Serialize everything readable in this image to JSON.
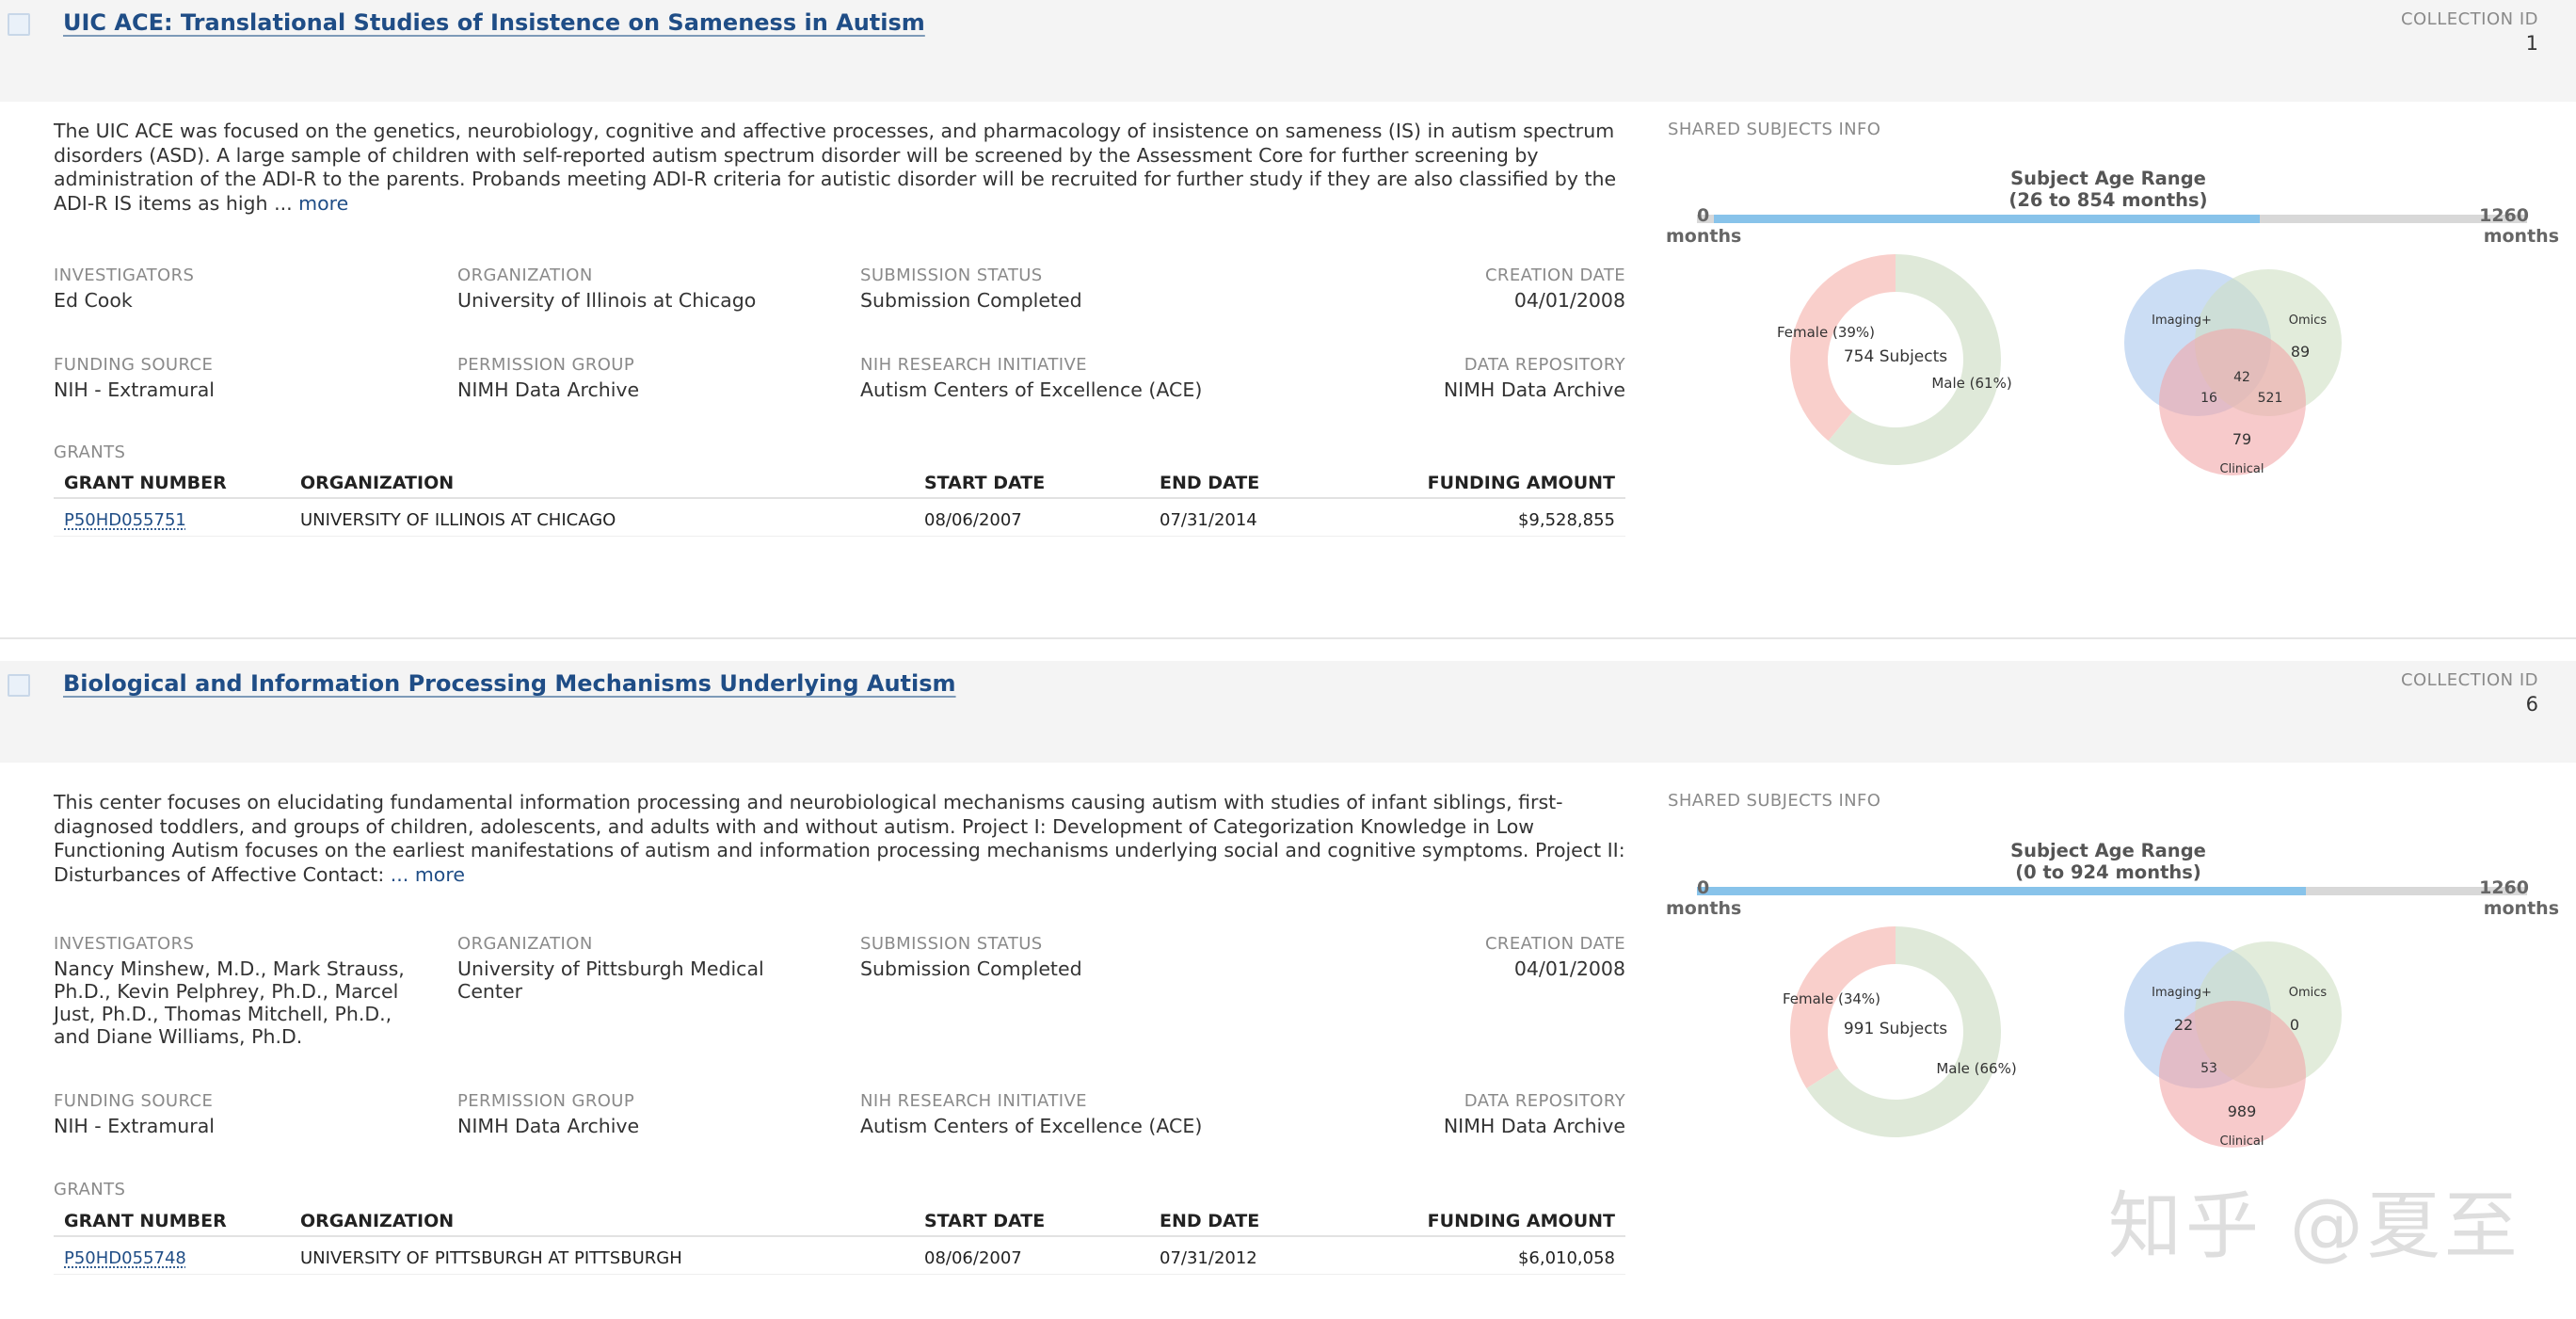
{
  "collections": [
    {
      "title": "UIC ACE: Translational Studies of Insistence on Sameness in Autism",
      "collection_id_label": "COLLECTION ID",
      "collection_id": "1",
      "description": "The UIC ACE was focused on the genetics, neurobiology, cognitive and affective processes, and pharmacology of insistence on sameness (IS) in autism spectrum disorders (ASD). A large sample of children with self-reported autism spectrum disorder will be screened by the Assessment Core for further screening by administration of the ADI-R to the parents. Probands meeting ADI-R criteria for autistic disorder will be recruited for further study if they are also classified by the ADI-R IS items as high ...",
      "more_label": "more",
      "investigators_label": "INVESTIGATORS",
      "investigators": "Ed Cook",
      "organization_label": "ORGANIZATION",
      "organization": "University of Illinois at Chicago",
      "submission_status_label": "SUBMISSION STATUS",
      "submission_status": "Submission Completed",
      "creation_date_label": "CREATION DATE",
      "creation_date": "04/01/2008",
      "funding_source_label": "FUNDING SOURCE",
      "funding_source": "NIH - Extramural",
      "permission_group_label": "PERMISSION GROUP",
      "permission_group": "NIMH Data Archive",
      "research_initiative_label": "NIH RESEARCH INITIATIVE",
      "research_initiative": "Autism Centers of Excellence (ACE)",
      "data_repository_label": "DATA REPOSITORY",
      "data_repository": "NIMH Data Archive",
      "grants_label": "GRANTS",
      "grants_headers": [
        "GRANT NUMBER",
        "ORGANIZATION",
        "START DATE",
        "END DATE",
        "FUNDING AMOUNT"
      ],
      "grants": [
        {
          "number": "P50HD055751",
          "organization": "UNIVERSITY OF ILLINOIS AT CHICAGO",
          "start": "08/06/2007",
          "end": "07/31/2014",
          "amount": "$9,528,855"
        }
      ],
      "shared_label": "SHARED SUBJECTS INFO",
      "age_range_title": "Subject Age Range",
      "age_range_sub": "(26 to 854 months)",
      "age_min_label": "0",
      "age_max_label": "1260",
      "age_unit": "months",
      "age_scale_max": 1260,
      "age_from": 26,
      "age_to": 854,
      "subjects_label": "754 Subjects",
      "female_label": "Female (39%)",
      "male_label": "Male (61%)",
      "female_fraction": 0.39,
      "venn": {
        "imaging_label": "Imaging+",
        "omics_label": "Omics",
        "clinical_label": "Clinical",
        "omics_only": "89",
        "center": "42",
        "imaging_clinical": "16",
        "omics_clinical": "521",
        "clinical_only": "79"
      }
    },
    {
      "title": "Biological and Information Processing Mechanisms Underlying Autism",
      "collection_id_label": "COLLECTION ID",
      "collection_id": "6",
      "description": "This center focuses on elucidating fundamental information processing and neurobiological mechanisms causing autism with studies of infant siblings, first-diagnosed toddlers, and groups of children, adolescents, and adults with and without autism. Project I: Development of Categorization Knowledge in Low Functioning Autism focuses on the earliest manifestations of autism and information processing mechanisms underlying social and cognitive symptoms. Project II: Disturbances of Affective Contact:",
      "more_label": "... more",
      "investigators_label": "INVESTIGATORS",
      "investigators": "Nancy Minshew, M.D., Mark Strauss, Ph.D., Kevin Pelphrey, Ph.D., Marcel Just, Ph.D., Thomas Mitchell, Ph.D., and Diane Williams, Ph.D.",
      "organization_label": "ORGANIZATION",
      "organization": "University of Pittsburgh Medical Center",
      "submission_status_label": "SUBMISSION STATUS",
      "submission_status": "Submission Completed",
      "creation_date_label": "CREATION DATE",
      "creation_date": "04/01/2008",
      "funding_source_label": "FUNDING SOURCE",
      "funding_source": "NIH - Extramural",
      "permission_group_label": "PERMISSION GROUP",
      "permission_group": "NIMH Data Archive",
      "research_initiative_label": "NIH RESEARCH INITIATIVE",
      "research_initiative": "Autism Centers of Excellence (ACE)",
      "data_repository_label": "DATA REPOSITORY",
      "data_repository": "NIMH Data Archive",
      "grants_label": "GRANTS",
      "grants_headers": [
        "GRANT NUMBER",
        "ORGANIZATION",
        "START DATE",
        "END DATE",
        "FUNDING AMOUNT"
      ],
      "grants": [
        {
          "number": "P50HD055748",
          "organization": "UNIVERSITY OF PITTSBURGH AT PITTSBURGH",
          "start": "08/06/2007",
          "end": "07/31/2012",
          "amount": "$6,010,058"
        }
      ],
      "shared_label": "SHARED SUBJECTS INFO",
      "age_range_title": "Subject Age Range",
      "age_range_sub": "(0 to 924 months)",
      "age_min_label": "0",
      "age_max_label": "1260",
      "age_unit": "months",
      "age_scale_max": 1260,
      "age_from": 0,
      "age_to": 924,
      "subjects_label": "991 Subjects",
      "female_label": "Female (34%)",
      "male_label": "Male (66%)",
      "female_fraction": 0.34,
      "venn": {
        "imaging_label": "Imaging+",
        "omics_label": "Omics",
        "clinical_label": "Clinical",
        "imaging_only": "22",
        "omics_only": "0",
        "imaging_clinical": "53",
        "clinical_only": "989"
      }
    }
  ],
  "watermark": "知乎 @夏至",
  "colors": {
    "link": "#1f4d86",
    "female": "#f9cfcb",
    "male": "#dfe9d9",
    "imaging": "#a9c6ec",
    "omics": "#cfe0c3",
    "clinical": "#f2a7a9",
    "age_fill": "#88c3ea",
    "age_track": "#d8d8d8"
  }
}
